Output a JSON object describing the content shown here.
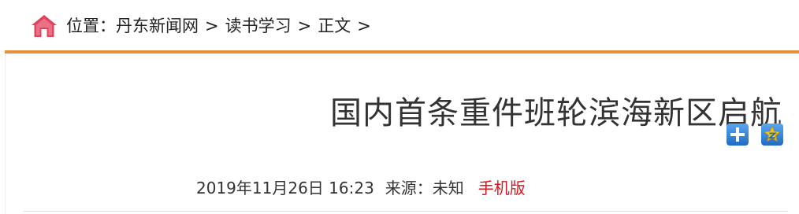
{
  "breadcrumb": {
    "label": "位置：",
    "items": [
      "丹东新闻网",
      "读书学习",
      "正文"
    ],
    "separator": ">"
  },
  "article": {
    "title": "国内首条重件班轮滨海新区启航",
    "datetime": "2019年11月26日 16:23",
    "source_label": "来源：",
    "source_value": "未知",
    "mobile_link": "手机版"
  },
  "colors": {
    "accent_orange": "#e8913a",
    "home_icon": "#e0445e",
    "mobile_link": "#d7171f",
    "share_blue": "#2f7fd6",
    "share_yellow": "#f3c317"
  },
  "icons": {
    "home": "home-icon",
    "share_plus": "plus-share-icon",
    "share_qzone": "qzone-share-icon"
  }
}
